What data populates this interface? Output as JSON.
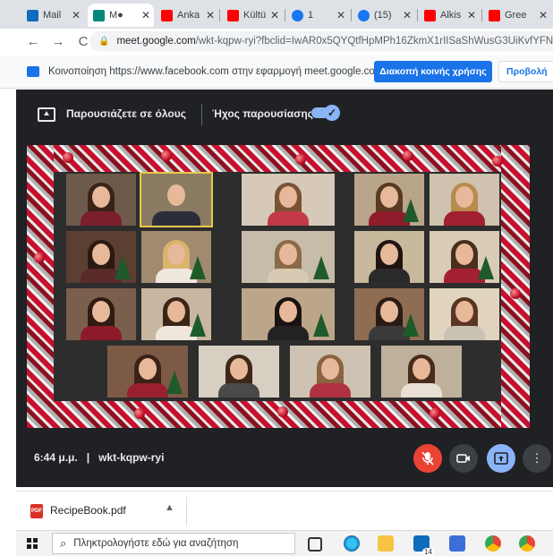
{
  "browser": {
    "tabs": [
      {
        "title": "Mail",
        "favicon": "outlook-icon",
        "color": "#0f6cbd"
      },
      {
        "title": "M●",
        "favicon": "meet-icon",
        "color": "#00897b",
        "active": true
      },
      {
        "title": "Anka",
        "favicon": "youtube-icon",
        "color": "#ff0000"
      },
      {
        "title": "Kültü",
        "favicon": "youtube-icon",
        "color": "#ff0000"
      },
      {
        "title": "1",
        "favicon": "facebook-icon",
        "color": "#1877f2"
      },
      {
        "title": "(15)",
        "favicon": "facebook-icon",
        "color": "#1877f2"
      },
      {
        "title": "Alkis",
        "favicon": "youtube-icon",
        "color": "#ff0000"
      },
      {
        "title": "Gree",
        "favicon": "youtube-icon",
        "color": "#ff0000"
      }
    ],
    "url_host": "meet.google.com",
    "url_path": "/wkt-kqpw-ryi?fbclid=IwAR0x5QYQtfHpMPh16ZkmX1rIISaShWusG3UiKvfYFN"
  },
  "sharebar": {
    "message": "Κοινοποίηση https://www.facebook.com στην εφαρμογή meet.google.com",
    "stop_label": "Διακοπή κοινής χρήσης",
    "switch_label": "Προβολή"
  },
  "meet": {
    "presenting_label": "Παρουσιάζετε σε όλους",
    "audio_label": "Ήχος παρουσίασης",
    "time": "6:44 μ.μ.",
    "separator": "|",
    "meeting_code": "wkt-kqpw-ryi"
  },
  "download": {
    "filename": "RecipeBook.pdf",
    "file_badge": "PDF"
  },
  "taskbar": {
    "search_placeholder": "Πληκτρολογήστε εδώ για αναζήτηση",
    "mail_badge": "14"
  },
  "colors": {
    "meet_bg": "#202124",
    "accent": "#1a73e8",
    "mic_off": "#ea4335"
  }
}
